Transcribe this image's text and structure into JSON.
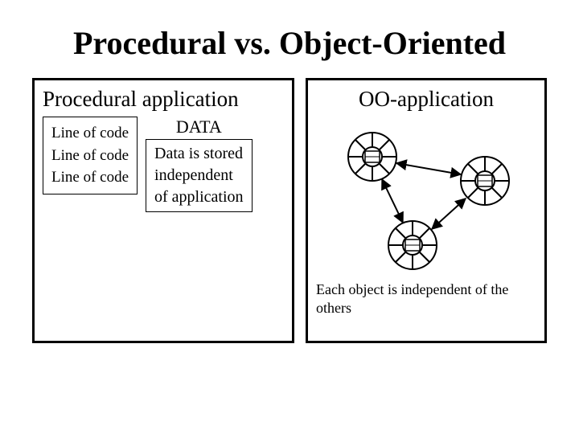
{
  "title": "Procedural vs. Object-Oriented",
  "left": {
    "heading": "Procedural application",
    "code_lines": [
      "Line of code",
      "Line of code",
      "Line of code"
    ],
    "data_label": "DATA",
    "data_text": [
      "Data is stored",
      "independent",
      "of application"
    ]
  },
  "right": {
    "heading": "OO-application",
    "caption": "Each object is independent of the others"
  }
}
